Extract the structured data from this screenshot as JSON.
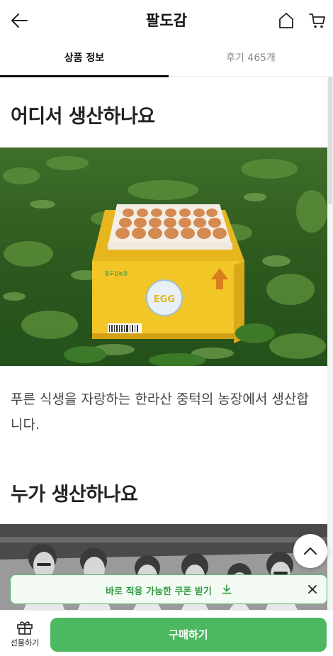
{
  "header": {
    "title": "팔도감",
    "back_icon": "arrow-left-icon",
    "home_icon": "home-icon",
    "cart_icon": "cart-icon"
  },
  "tabs": [
    {
      "label": "상품 정보",
      "active": true
    },
    {
      "label": "후기 465개",
      "active": false
    }
  ],
  "sections": [
    {
      "heading": "어디서 생산하나요",
      "image_box_label": "EGG",
      "image_brand": "팔도감농장",
      "paragraph": "푸른 식생을 자랑하는 한라산 중턱의 농장에서 생산합니다."
    },
    {
      "heading": "누가 생산하나요"
    }
  ],
  "coupon": {
    "label": "바로 적용 가능한 쿠폰 받기",
    "download_icon": "download-icon",
    "close_icon": "close-icon"
  },
  "bottom_bar": {
    "gift_label": "선물하기",
    "gift_icon": "gift-icon",
    "buy_label": "구매하기"
  },
  "colors": {
    "accent_green": "#4cb85f",
    "coupon_text": "#2e9a41",
    "box_yellow": "#f2c627"
  }
}
